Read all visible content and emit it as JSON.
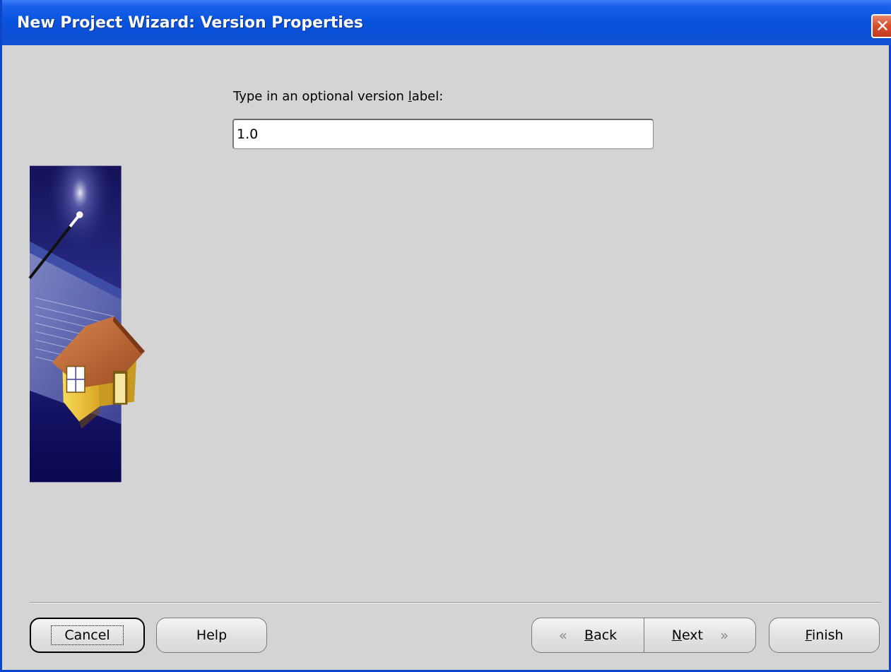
{
  "window": {
    "title": "New Project Wizard: Version Properties",
    "close_glyph": "✕"
  },
  "form": {
    "prompt_before": "Type in an optional version ",
    "prompt_mnemonic": "l",
    "prompt_after": "abel:",
    "version_value": "1.0"
  },
  "buttons": {
    "cancel": "Cancel",
    "help": "Help",
    "back_arrow": "«",
    "back_mnemonic": "B",
    "back_rest": "ack",
    "next_mnemonic": "N",
    "next_rest": "ext",
    "next_arrow": "»",
    "finish_mnemonic": "F",
    "finish_rest": "inish"
  },
  "colors": {
    "titlebar": "#0953dd",
    "dialog_bg": "#d4d4d4",
    "graphic_bg": "#1a1a6e"
  },
  "icons": {
    "close": "close-icon",
    "graphic": "wizard-house-illustration"
  }
}
